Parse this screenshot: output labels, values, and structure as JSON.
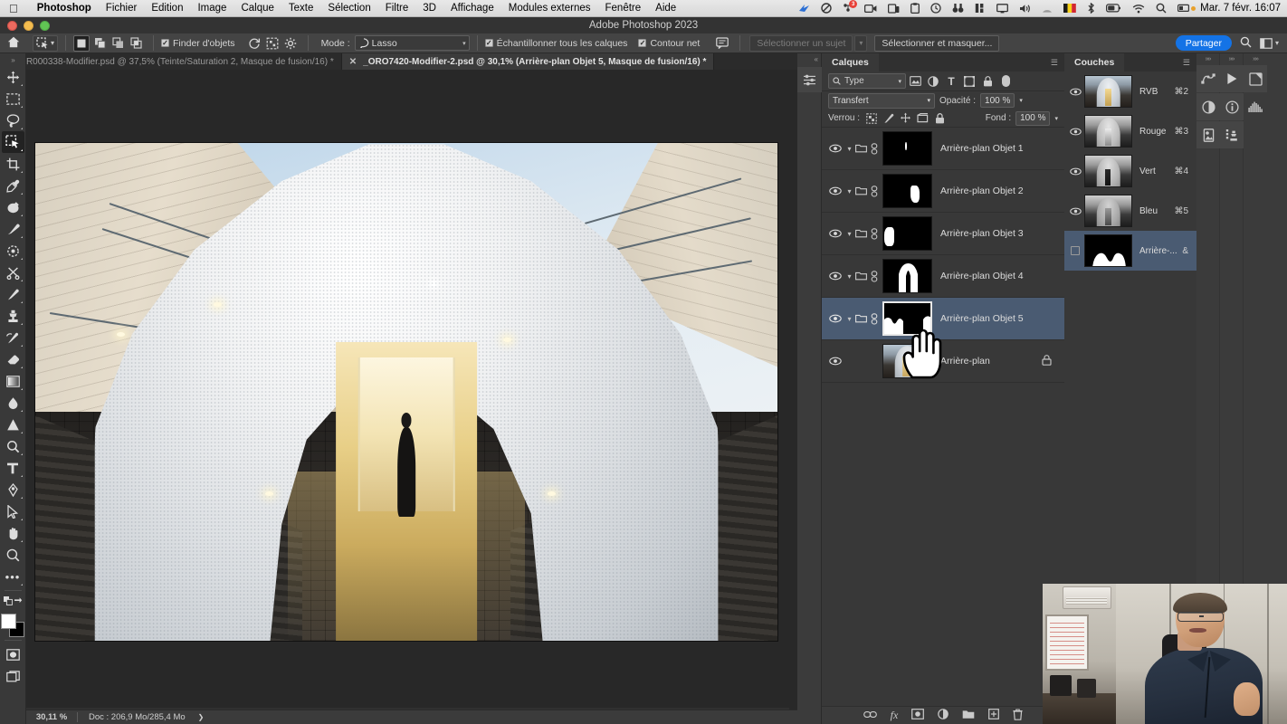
{
  "macos_menubar": {
    "apple_icon": "apple-icon",
    "app_name": "Photoshop",
    "menus": [
      "Fichier",
      "Edition",
      "Image",
      "Calque",
      "Texte",
      "Sélection",
      "Filtre",
      "3D",
      "Affichage",
      "Modules externes",
      "Fenêtre",
      "Aide"
    ],
    "status_icons": [
      "bird-icon",
      "no-entry-icon",
      "notifications-icon",
      "screen-record-icon",
      "device-icon",
      "clipboard-icon",
      "clock-icon",
      "binoculars-icon",
      "stats-icon",
      "display-icon",
      "volume-icon",
      "wifi-signal-icon",
      "belgium-flag-icon",
      "bluetooth-icon",
      "battery-icon",
      "wifi-icon",
      "search-icon",
      "control-center-icon"
    ],
    "notification_badge": "3",
    "clock": "Mar. 7 févr.  16:07"
  },
  "window": {
    "title": "Adobe Photoshop 2023",
    "traffic_lights": [
      "close-button",
      "minimize-button",
      "zoom-button"
    ]
  },
  "options_bar": {
    "home_icon": "home-icon",
    "tool_icon": "object-selection-tool-icon",
    "tool_caret": "chevron-down-icon",
    "selection_modes": [
      "new-selection-icon",
      "add-to-selection-icon",
      "subtract-from-selection-icon",
      "intersect-selection-icon"
    ],
    "active_selection_mode_index": 0,
    "object_finder_label": "Finder d'objets",
    "object_finder_checked": true,
    "refresh_icon": "refresh-icon",
    "overlay_icon": "overlay-options-icon",
    "settings_icon": "gear-icon",
    "mode_label": "Mode :",
    "mode_value": "Lasso",
    "mode_icon": "lasso-icon",
    "sample_all_layers_label": "Échantillonner tous les calques",
    "sample_all_layers_checked": true,
    "hard_edge_label": "Contour net",
    "hard_edge_checked": true,
    "feedback_icon": "feedback-icon",
    "select_subject_label": "Sélectionner un sujet",
    "select_subject_caret": "chevron-down-icon",
    "select_and_mask_label": "Sélectionner et masquer...",
    "share_label": "Partager",
    "search_icon": "search-icon",
    "workspace_icon": "workspace-icon",
    "workspace_caret": "chevron-down-icon"
  },
  "document_tabs": [
    {
      "label": "_R000338-Modifier.psd @ 37,5% (Teinte/Saturation 2, Masque de fusion/16) *",
      "active": false,
      "close_icon": "close-icon"
    },
    {
      "label": "_ORO7420-Modifier-2.psd @ 30,1% (Arrière-plan Objet 5, Masque de fusion/16) *",
      "active": true,
      "close_icon": "close-icon"
    }
  ],
  "toolbar": {
    "collapse_icon": "double-chevron-icon",
    "tools": [
      {
        "name": "move-tool-icon",
        "glyph": "✥",
        "selected": false,
        "has_submenu": true
      },
      {
        "name": "rectangular-marquee-tool-icon",
        "glyph": "▭",
        "selected": false,
        "has_submenu": true
      },
      {
        "name": "lasso-tool-icon",
        "glyph": "◠",
        "selected": false,
        "has_submenu": true
      },
      {
        "name": "object-selection-tool-icon",
        "glyph": "⬚",
        "selected": true,
        "has_submenu": true
      },
      {
        "name": "crop-tool-icon",
        "glyph": "⌗",
        "selected": false,
        "has_submenu": true
      },
      {
        "name": "eyedropper-tool-icon",
        "glyph": "⚲",
        "selected": false,
        "has_submenu": true
      },
      {
        "name": "spot-healing-brush-tool-icon",
        "glyph": "◕",
        "selected": false,
        "has_submenu": true
      },
      {
        "name": "brush-tool-icon",
        "glyph": "✎",
        "selected": false,
        "has_submenu": true
      },
      {
        "name": "patch-tool-icon",
        "glyph": "◌",
        "selected": false,
        "has_submenu": true
      },
      {
        "name": "scissors-tool-icon",
        "glyph": "✂",
        "selected": false,
        "has_submenu": true
      },
      {
        "name": "paint-brush-tool-icon",
        "glyph": "╱",
        "selected": false,
        "has_submenu": true
      },
      {
        "name": "clone-stamp-tool-icon",
        "glyph": "⚑",
        "selected": false,
        "has_submenu": true
      },
      {
        "name": "history-brush-tool-icon",
        "glyph": "✒",
        "selected": false,
        "has_submenu": true
      },
      {
        "name": "eraser-tool-icon",
        "glyph": "◣",
        "selected": false,
        "has_submenu": true
      },
      {
        "name": "gradient-tool-icon",
        "glyph": "▤",
        "selected": false,
        "has_submenu": true
      },
      {
        "name": "blur-tool-icon",
        "glyph": "◗",
        "selected": false,
        "has_submenu": true
      },
      {
        "name": "dodge-tool-icon",
        "glyph": "▲",
        "selected": false,
        "has_submenu": true
      },
      {
        "name": "burn-tool-icon",
        "glyph": "◔",
        "selected": false,
        "has_submenu": true
      },
      {
        "name": "type-tool-icon",
        "glyph": "T",
        "selected": false,
        "has_submenu": true
      },
      {
        "name": "pen-tool-icon",
        "glyph": "✐",
        "selected": false,
        "has_submenu": true
      },
      {
        "name": "path-selection-tool-icon",
        "glyph": "➤",
        "selected": false,
        "has_submenu": true
      },
      {
        "name": "hand-tool-icon",
        "glyph": "✋",
        "selected": false,
        "has_submenu": true
      },
      {
        "name": "zoom-tool-icon",
        "glyph": "⚲",
        "selected": false,
        "has_submenu": false
      },
      {
        "name": "more-tools-icon",
        "glyph": "•••",
        "selected": false,
        "has_submenu": true
      }
    ],
    "swap_colors_icon": "swap-colors-icon",
    "default_colors_icon": "default-colors-icon",
    "foreground_color": "#ffffff",
    "background_color": "#000000",
    "quick_mask_icon": "quick-mask-icon",
    "screen_mode_icon": "screen-mode-icon"
  },
  "canvas": {
    "image_description": "architectural-photo-white-arch-entrance",
    "vertical_scrollbar": "vertical-scrollbar",
    "horizontal_scrollbar": "horizontal-scrollbar"
  },
  "status_bar": {
    "zoom_level": "30,11 %",
    "doc_info": "Doc : 206,9 Mo/285,4 Mo",
    "expand_icon": "chevron-right-icon"
  },
  "panel_strip": {
    "collapse_icon": "double-chevron-left-icon",
    "adjustments_icon": "adjustments-sliders-icon"
  },
  "layers_panel": {
    "tab_label": "Calques",
    "menu_icon": "panel-menu-icon",
    "filter": {
      "search_icon": "search-icon",
      "value": "Type",
      "caret_icon": "chevron-down-icon",
      "type_icons": [
        "image-filter-icon",
        "adjustment-filter-icon",
        "text-filter-icon",
        "shape-filter-icon",
        "smart-object-filter-icon"
      ],
      "toggle_icon": "filter-toggle-icon"
    },
    "blend_mode_label": "Transfert",
    "blend_caret_icon": "chevron-down-icon",
    "opacity_label": "Opacité :",
    "opacity_value": "100 %",
    "opacity_caret_icon": "chevron-down-icon",
    "lock_label": "Verrou :",
    "lock_icons": [
      "lock-transparency-icon",
      "lock-image-icon",
      "lock-position-icon",
      "lock-artboard-icon",
      "lock-all-icon"
    ],
    "fill_label": "Fond :",
    "fill_value": "100 %",
    "fill_caret_icon": "chevron-down-icon",
    "rows": [
      {
        "name": "Arrière-plan Objet 1",
        "visible": true,
        "selected": false,
        "locked": false,
        "kind": "mask",
        "eye_icon": "eye-icon",
        "chevron_icon": "chevron-down-icon",
        "folder_icon": "folder-icon",
        "link_icon": "link-icon"
      },
      {
        "name": "Arrière-plan Objet 2",
        "visible": true,
        "selected": false,
        "locked": false,
        "kind": "mask",
        "eye_icon": "eye-icon",
        "chevron_icon": "chevron-down-icon",
        "folder_icon": "folder-icon",
        "link_icon": "link-icon"
      },
      {
        "name": "Arrière-plan Objet 3",
        "visible": true,
        "selected": false,
        "locked": false,
        "kind": "mask",
        "eye_icon": "eye-icon",
        "chevron_icon": "chevron-down-icon",
        "folder_icon": "folder-icon",
        "link_icon": "link-icon"
      },
      {
        "name": "Arrière-plan Objet 4",
        "visible": true,
        "selected": false,
        "locked": false,
        "kind": "mask",
        "eye_icon": "eye-icon",
        "chevron_icon": "chevron-down-icon",
        "folder_icon": "folder-icon",
        "link_icon": "link-icon"
      },
      {
        "name": "Arrière-plan Objet 5",
        "visible": true,
        "selected": true,
        "locked": false,
        "kind": "mask",
        "eye_icon": "eye-icon",
        "chevron_icon": "chevron-down-icon",
        "folder_icon": "folder-icon",
        "link_icon": "link-icon"
      },
      {
        "name": "Arrière-plan",
        "visible": true,
        "selected": false,
        "locked": true,
        "kind": "photo",
        "eye_icon": "eye-icon",
        "lock_badge_icon": "lock-icon"
      }
    ],
    "bottom_icons": [
      "link-layers-icon",
      "layer-style-fx-icon",
      "add-mask-icon",
      "adjustment-layer-icon",
      "new-group-icon",
      "new-layer-icon",
      "delete-layer-icon"
    ],
    "highlight_color": "#4a5b72"
  },
  "channels_panel": {
    "tab_label": "Couches",
    "menu_icon": "panel-menu-icon",
    "rows": [
      {
        "name": "RVB",
        "shortcut": "⌘2",
        "visible": true,
        "selected": false,
        "eye_icon": "eye-icon",
        "thumb": "rgb-composite"
      },
      {
        "name": "Rouge",
        "shortcut": "⌘3",
        "visible": true,
        "selected": false,
        "eye_icon": "eye-icon",
        "thumb": "grayscale"
      },
      {
        "name": "Vert",
        "shortcut": "⌘4",
        "visible": true,
        "selected": false,
        "eye_icon": "eye-icon",
        "thumb": "grayscale"
      },
      {
        "name": "Bleu",
        "shortcut": "⌘5",
        "visible": true,
        "selected": false,
        "eye_icon": "eye-icon",
        "thumb": "grayscale"
      },
      {
        "name": "Arrière-...",
        "shortcut": "&",
        "visible": false,
        "selected": true,
        "eye_icon": "eye-icon",
        "thumb": "mask"
      }
    ],
    "bottom_icons": [
      "load-selection-icon",
      "save-selection-icon",
      "new-channel-icon",
      "delete-channel-icon"
    ]
  },
  "right_dock": {
    "columns": [
      {
        "handle_icon": "double-chevron-icon",
        "icons": [
          "paths-panel-icon",
          "adjustments-panel-icon",
          "libraries-panel-icon"
        ]
      },
      {
        "handle_icon": "double-chevron-icon",
        "icons": [
          "actions-panel-icon",
          "info-panel-icon",
          "clone-source-panel-icon"
        ]
      },
      {
        "handle_icon": "double-chevron-icon",
        "icons": [
          "notes-panel-icon",
          "histogram-panel-icon"
        ]
      }
    ]
  },
  "cursor": {
    "type": "hand-cursor",
    "position_label": "over Arrière-plan Objet 5 mask thumbnail"
  },
  "webcam_overlay": {
    "description": "presenter-speaking-in-office",
    "name": "webcam-video-overlay"
  }
}
